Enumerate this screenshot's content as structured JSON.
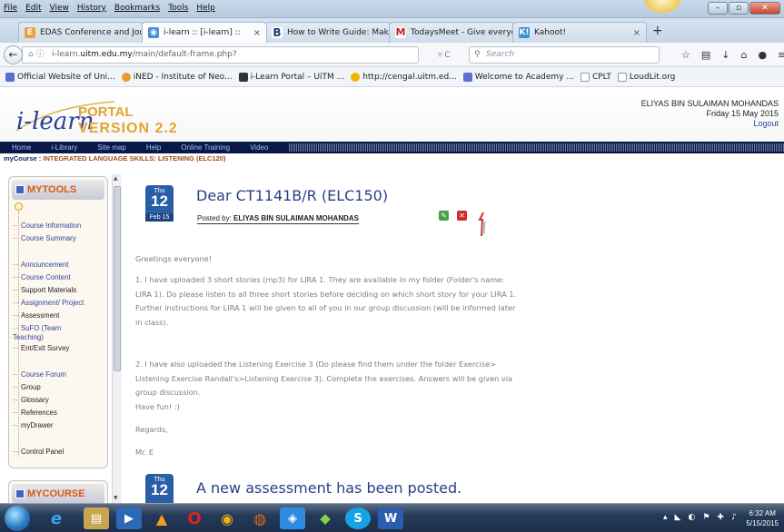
{
  "browser": {
    "menu": [
      "File",
      "Edit",
      "View",
      "History",
      "Bookmarks",
      "Tools",
      "Help"
    ],
    "tabs": [
      {
        "title": "EDAS Conference and Jour...",
        "icon": "edas-icon"
      },
      {
        "title": "i-learn :: [i-learn] ::",
        "icon": "ilearn-tab-icon",
        "active": true
      },
      {
        "title": "How to Write Guide: Makin...",
        "icon": "bibme-icon"
      },
      {
        "title": "TodaysMeet - Give everyo...",
        "icon": "todaysmeet-icon"
      },
      {
        "title": "Kahoot!",
        "icon": "kahoot-icon"
      }
    ],
    "url_prefix": "i-learn.",
    "url_domain": "uitm.edu.my",
    "url_path": "/main/default-frame.php?",
    "search_placeholder": "Search",
    "bookmarks": [
      "Official Website of Uni...",
      "iNED - Institute of Neo...",
      "i-Learn Portal – UiTM ...",
      "http://cengal.uitm.ed...",
      "Welcome to Academy ...",
      "CPLT",
      "LoudLit.org"
    ]
  },
  "header": {
    "logo_script": "i-learn",
    "logo_line1": "PORTAL",
    "logo_line2": "VERSION 2.2",
    "user_name": "ELIYAS BIN SULAIMAN MOHANDAS",
    "date": "Friday 15 May 2015",
    "logout": "Logout"
  },
  "nav": [
    "Home",
    "i-Library",
    "Site map",
    "Help",
    "Online Training",
    "Video"
  ],
  "breadcrumb": {
    "label": "myCourse :",
    "course": "INTEGRATED LANGUAGE SKILLS: LISTENING (ELC120)"
  },
  "sidebar": {
    "mytools_title": "MYTOOLS",
    "mycourse_title": "MYCOURSE",
    "items": [
      {
        "label": "Course Information",
        "link": true
      },
      {
        "label": "Course Summary",
        "link": true
      },
      {
        "label": "Announcement",
        "link": true
      },
      {
        "label": "Course Content",
        "link": true
      },
      {
        "label": "Support Materials",
        "link": false
      },
      {
        "label": "Assignment/ Project",
        "link": true
      },
      {
        "label": "Assessment",
        "link": false
      },
      {
        "label": "SuFO (Team",
        "link": true
      },
      {
        "label": "Teaching)",
        "link": true
      },
      {
        "label": "Ent/Exit Survey",
        "link": false
      },
      {
        "label": "Course Forum",
        "link": true
      },
      {
        "label": "Group",
        "link": false
      },
      {
        "label": "Glossary",
        "link": false
      },
      {
        "label": "References",
        "link": false
      },
      {
        "label": "myDrawer",
        "link": false
      },
      {
        "label": "Control Panel",
        "link": false
      }
    ]
  },
  "posts": [
    {
      "dow": "Thu",
      "day": "12",
      "month": "Feb 15",
      "title": "Dear CT1141B/R (ELC150)",
      "posted_by_label": "Posted by:",
      "posted_by": "ELIYAS BIN SULAIMAN MOHANDAS",
      "paragraphs": [
        "Greetings everyone!",
        "1. I have uploaded 3 short stories (mp3) for LIRA 1. They are available in my folder (Folder's name: LIRA 1). Do please listen to all three short stories before deciding on which short story for your LIRA 1. Further instructions for LIRA 1 will be given to all of you in our group discussion (will be informed later in class).",
        "2. I have also uploaded the Listening Exercise 3 (Do please find them under the folder Exercise> Listening Exercise Randall's>Listening Exercise 3). Complete the exercises. Answers will be given via group discussion.",
        "Have fun! :)",
        "Regards,",
        "Mr. E"
      ]
    },
    {
      "dow": "Thu",
      "day": "12",
      "title": "A new assessment has been posted."
    }
  ],
  "taskbar": {
    "time": "6:32 AM",
    "date": "5/15/2015"
  }
}
